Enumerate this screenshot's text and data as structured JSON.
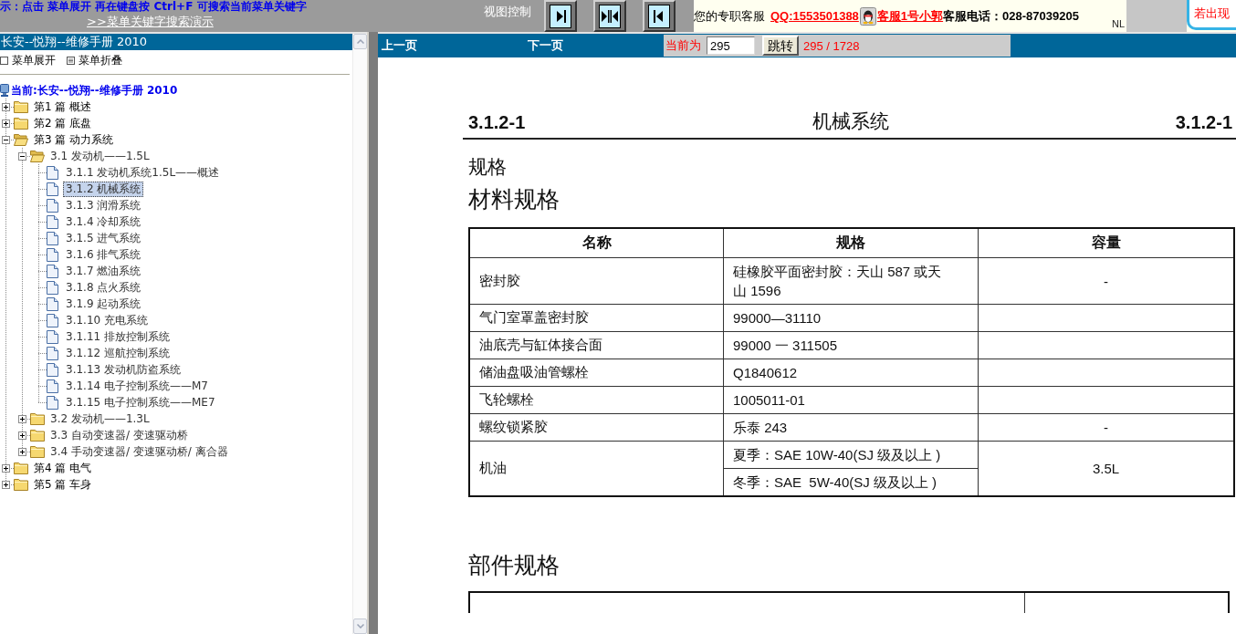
{
  "top_bar": {
    "hint": "示：点击 菜单展开 再在键盘按 Ctrl+F 可搜索当前菜单关键字",
    "demo_link": ">>菜单关键字搜索演示",
    "view_control_label": "视图控制",
    "support_label": "您的专职客服",
    "qq_link": "QQ:1553501388",
    "agent_link": "客服1号小郭",
    "phone": "客服电话：028-87039205",
    "image_caption": "NL",
    "notice": "若出现"
  },
  "left_panel": {
    "title": "长安--悦翔--维修手册 2010",
    "menu_actions": [
      {
        "kind": "expand",
        "label": "菜单展开"
      },
      {
        "kind": "collapse",
        "label": "菜单折叠"
      }
    ],
    "tree": {
      "root": "当前:长安--悦翔--维修手册 2010",
      "items": [
        {
          "kind": "folder",
          "label": "第1 篇 概述",
          "expanded": false,
          "selected": false
        },
        {
          "kind": "folder",
          "label": "第2 篇 底盘",
          "expanded": false,
          "selected": false
        },
        {
          "kind": "folder",
          "label": "第3 篇 动力系统",
          "expanded": true,
          "selected": false,
          "children": [
            {
              "kind": "folder",
              "label": "3.1 发动机——1.5L",
              "expanded": true,
              "selected": false,
              "children": [
                {
                  "kind": "page",
                  "label": "3.1.1 发动机系统1.5L——概述",
                  "selected": false
                },
                {
                  "kind": "page",
                  "label": "3.1.2 机械系统",
                  "selected": true
                },
                {
                  "kind": "page",
                  "label": "3.1.3 润滑系统",
                  "selected": false
                },
                {
                  "kind": "page",
                  "label": "3.1.4 冷却系统",
                  "selected": false
                },
                {
                  "kind": "page",
                  "label": "3.1.5 进气系统",
                  "selected": false
                },
                {
                  "kind": "page",
                  "label": "3.1.6 排气系统",
                  "selected": false
                },
                {
                  "kind": "page",
                  "label": "3.1.7 燃油系统",
                  "selected": false
                },
                {
                  "kind": "page",
                  "label": "3.1.8 点火系统",
                  "selected": false
                },
                {
                  "kind": "page",
                  "label": "3.1.9 起动系统",
                  "selected": false
                },
                {
                  "kind": "page",
                  "label": "3.1.10 充电系统",
                  "selected": false
                },
                {
                  "kind": "page",
                  "label": "3.1.11 排放控制系统",
                  "selected": false
                },
                {
                  "kind": "page",
                  "label": "3.1.12 巡航控制系统",
                  "selected": false
                },
                {
                  "kind": "page",
                  "label": "3.1.13 发动机防盗系统",
                  "selected": false
                },
                {
                  "kind": "page",
                  "label": "3.1.14 电子控制系统——M7",
                  "selected": false
                },
                {
                  "kind": "page",
                  "label": "3.1.15 电子控制系统——ME7",
                  "selected": false
                }
              ]
            },
            {
              "kind": "folder",
              "label": "3.2 发动机——1.3L",
              "expanded": false,
              "selected": false
            },
            {
              "kind": "folder",
              "label": "3.3 自动变速器/ 变速驱动桥",
              "expanded": false,
              "selected": false
            },
            {
              "kind": "folder",
              "label": "3.4 手动变速器/ 变速驱动桥/ 离合器",
              "expanded": false,
              "selected": false
            }
          ]
        },
        {
          "kind": "folder",
          "label": "第4 篇 电气",
          "expanded": false,
          "selected": false
        },
        {
          "kind": "folder",
          "label": "第5 篇 车身",
          "expanded": false,
          "selected": false
        }
      ]
    }
  },
  "viewer": {
    "nav": {
      "prev": "上一页",
      "next": "下一页",
      "current_label": "当前为",
      "page_input": "295",
      "go_button": "跳转",
      "page_count": "295 / 1728"
    },
    "document": {
      "page_id_left": "3.1.2-1",
      "title": "机械系统",
      "page_id_right": "3.1.2-1",
      "section": "规格",
      "subsection": "材料规格",
      "table": {
        "columns": [
          "名称",
          "规格",
          "容量"
        ],
        "rows": [
          {
            "name": "密封胶",
            "specs": [
              "硅橡胶平面密封胶：天山 587 或天山 1596"
            ],
            "capacity": "-"
          },
          {
            "name": "气门室罩盖密封胶",
            "specs": [
              "99000—31110"
            ]
          },
          {
            "name": "油底壳与缸体接合面",
            "specs": [
              "99000 一 311505"
            ]
          },
          {
            "name": "储油盘吸油管螺栓",
            "specs": [
              "Q1840612"
            ]
          },
          {
            "name": "飞轮螺栓",
            "specs": [
              "1005011-01"
            ]
          },
          {
            "name": "螺纹锁紧胶",
            "specs": [
              "乐泰 243"
            ],
            "capacity": "-"
          },
          {
            "name": "机油",
            "specs": [
              "夏季：SAE 10W-40(SJ 级及以上 )",
              "冬季：SAE  5W-40(SJ 级及以上 )"
            ],
            "capacity": "3.5L"
          }
        ]
      },
      "next_subsection": "部件规格"
    }
  }
}
